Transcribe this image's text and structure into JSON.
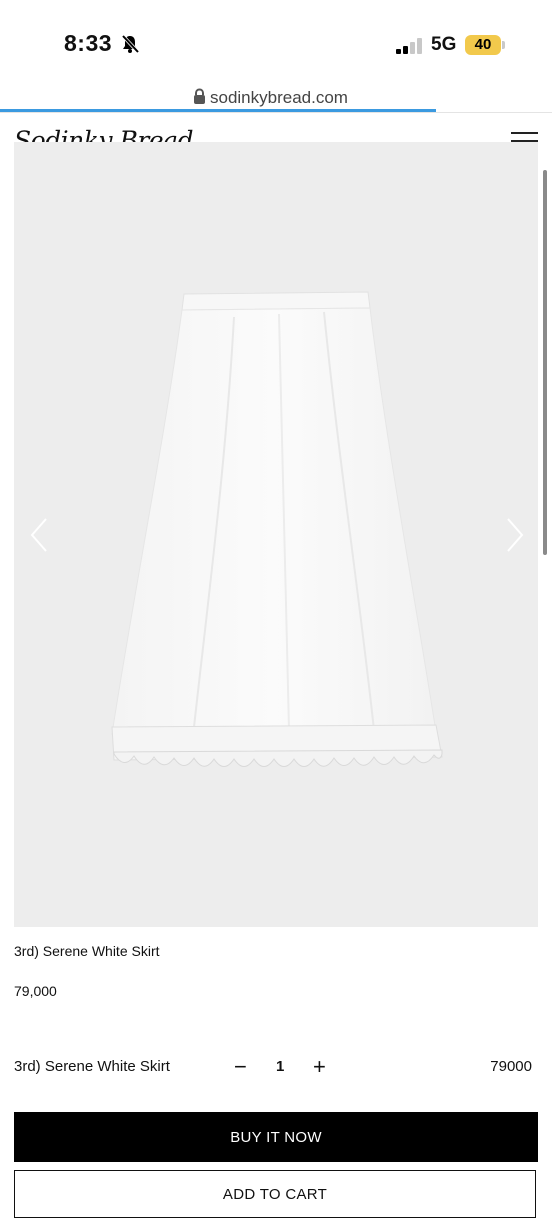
{
  "status_bar": {
    "time": "8:33",
    "network": "5G",
    "battery": "40",
    "icons": [
      "bell-slash-icon",
      "signal-icon"
    ]
  },
  "browser": {
    "url": "sodinkybread.com",
    "load_progress_percent": 79
  },
  "site": {
    "logo_text": "Sodinky Bread",
    "menu_icon": "hamburger-menu-icon"
  },
  "product": {
    "title": "3rd) Serene White Skirt",
    "price": "79,000",
    "image_description_icon": "skirt-photo",
    "gallery_prev_icon": "chevron-left-icon",
    "gallery_next_icon": "chevron-right-icon"
  },
  "selected_option": {
    "name": "3rd) Serene White Skirt",
    "minus": "−",
    "quantity": "1",
    "plus": "+",
    "price": "79000"
  },
  "actions": {
    "buy_now": "BUY IT NOW",
    "add_to_cart": "ADD TO CART"
  },
  "colors": {
    "battery": "#f2c94c",
    "progress": "#3b9ae0",
    "image_background": "#ededed",
    "primary_button": "#000000"
  }
}
